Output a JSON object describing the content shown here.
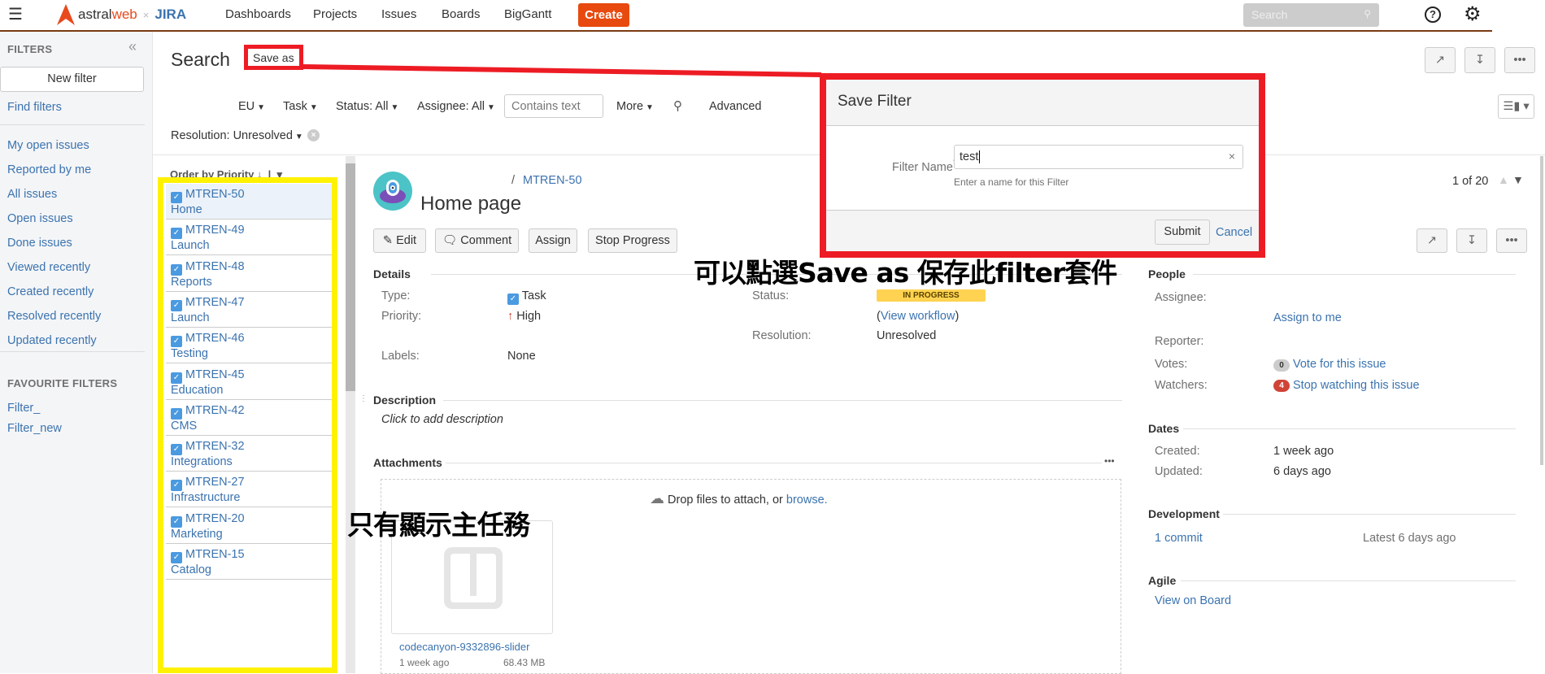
{
  "header": {
    "logo": {
      "brand_a": "astral",
      "brand_b": "web",
      "separator": "×",
      "product": "JIRA"
    },
    "nav": [
      "Dashboards",
      "Projects",
      "Issues",
      "Boards",
      "BigGantt"
    ],
    "create_label": "Create",
    "search_placeholder": "Search",
    "icons": [
      "menu-icon",
      "help-icon",
      "gear-icon"
    ],
    "accent": "#e8490f"
  },
  "sidebar": {
    "title": "FILTERS",
    "collapse": "«",
    "new_filter": "New filter",
    "find_filters": "Find filters",
    "items": [
      "My open issues",
      "Reported by me",
      "All issues",
      "Open issues",
      "Done issues",
      "Viewed recently",
      "Created recently",
      "Resolved recently",
      "Updated recently"
    ],
    "favourites_title": "FAVOURITE FILTERS",
    "favourites": [
      "Filter_",
      "Filter_new"
    ]
  },
  "search": {
    "title": "Search",
    "save_as": "Save as",
    "filters": [
      "EU",
      "Task",
      "Status: All",
      "Assignee: All"
    ],
    "text_placeholder": "Contains text",
    "more": "More",
    "advanced": "Advanced",
    "resolution": "Resolution: Unresolved"
  },
  "list": {
    "order_by": "Order by Priority",
    "items": [
      {
        "key": "MTREN-50",
        "summary": "Home"
      },
      {
        "key": "MTREN-49",
        "summary": "Launch"
      },
      {
        "key": "MTREN-48",
        "summary": "Reports"
      },
      {
        "key": "MTREN-47",
        "summary": "Launch"
      },
      {
        "key": "MTREN-46",
        "summary": "Testing"
      },
      {
        "key": "MTREN-45",
        "summary": "Education"
      },
      {
        "key": "MTREN-42",
        "summary": "CMS"
      },
      {
        "key": "MTREN-32",
        "summary": "Integrations"
      },
      {
        "key": "MTREN-27",
        "summary": "Infrastructure"
      },
      {
        "key": "MTREN-20",
        "summary": "Marketing"
      },
      {
        "key": "MTREN-15",
        "summary": "Catalog"
      }
    ]
  },
  "issue": {
    "breadcrumb_sep": "/",
    "key": "MTREN-50",
    "title": "Home page",
    "actions": [
      "Edit",
      "Comment",
      "Assign",
      "Stop Progress"
    ],
    "pager": "1 of 20",
    "details": {
      "heading": "Details",
      "type_label": "Type:",
      "type": "Task",
      "priority_label": "Priority:",
      "priority": "High",
      "labels_label": "Labels:",
      "labels": "None",
      "status_label": "Status:",
      "status": "IN PROGRESS",
      "workflow_open": "(",
      "workflow": "View workflow",
      "workflow_close": ")",
      "resolution_label": "Resolution:",
      "resolution": "Unresolved"
    },
    "description": {
      "heading": "Description",
      "placeholder": "Click to add description"
    },
    "attachments": {
      "heading": "Attachments",
      "drop_text": "Drop files to attach, or ",
      "browse": "browse.",
      "file": {
        "name": "codecanyon-9332896-slider",
        "date": "1 week ago",
        "size": "68.43 MB"
      }
    },
    "people": {
      "heading": "People",
      "assignee_label": "Assignee:",
      "assign_to_me": "Assign to me",
      "reporter_label": "Reporter:",
      "votes_label": "Votes:",
      "votes": "0",
      "vote_link": "Vote for this issue",
      "watchers_label": "Watchers:",
      "watchers": "4",
      "watch_link": "Stop watching this issue"
    },
    "dates": {
      "heading": "Dates",
      "created_label": "Created:",
      "created": "1 week ago",
      "updated_label": "Updated:",
      "updated": "6 days ago"
    },
    "development": {
      "heading": "Development",
      "commits": "1 commit",
      "latest": "Latest 6 days ago"
    },
    "agile": {
      "heading": "Agile",
      "board": "View on Board"
    },
    "status_color": "#ffd351",
    "watch_color": "#d04437"
  },
  "dialog": {
    "title": "Save Filter",
    "field_label": "Filter Name",
    "required": "*",
    "value": "test",
    "helper": "Enter a name for this Filter",
    "submit": "Submit",
    "cancel": "Cancel"
  },
  "annotations": {
    "save_hint": "可以點選Save as 保存此filter套件",
    "list_hint": "只有顯示主任務",
    "highlight_red": "#ed1c24",
    "highlight_yellow": "#fff200"
  }
}
